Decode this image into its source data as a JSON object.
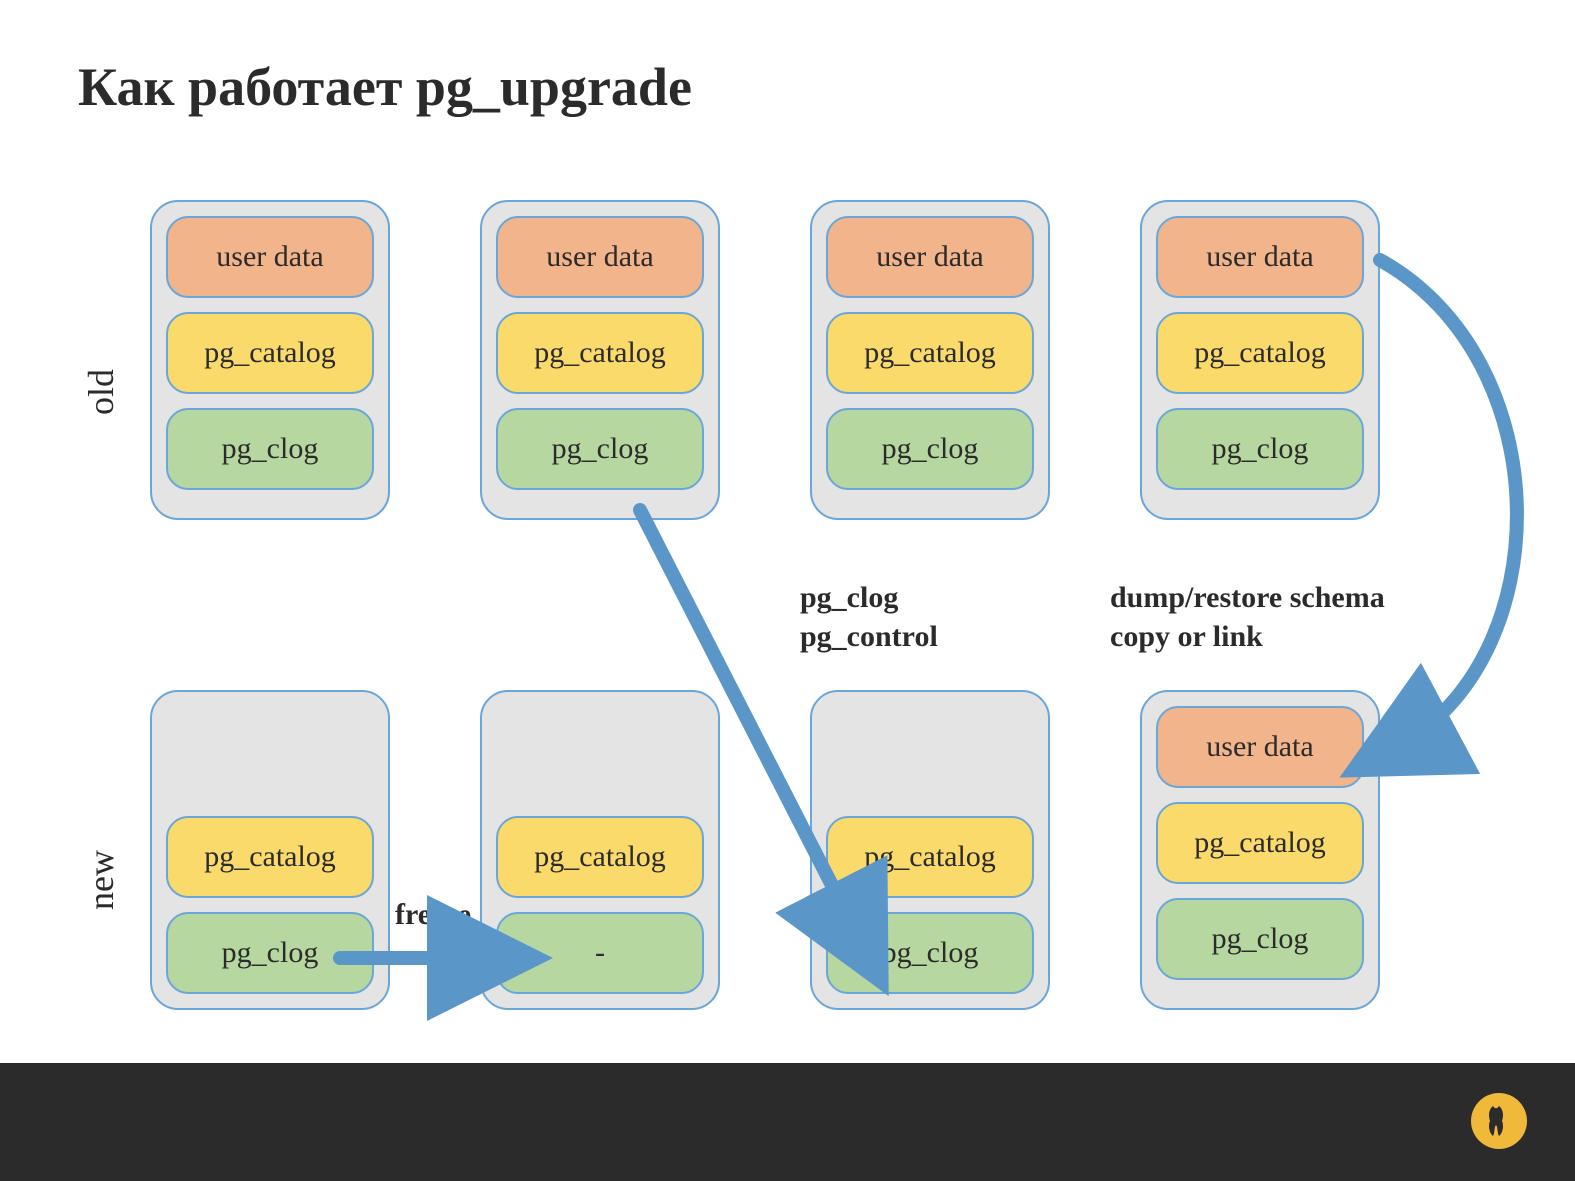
{
  "title": "Как работает pg_upgrade",
  "rows": {
    "old": "old",
    "new": "new"
  },
  "boxes": {
    "user_data": "user data",
    "catalog": "pg_catalog",
    "clog": "pg_clog",
    "dash": "-"
  },
  "annotations": {
    "freeze": "freeze",
    "col3_line1": "pg_clog",
    "col3_line2": "pg_control",
    "col4_line1": "dump/restore schema",
    "col4_line2": "copy or link"
  },
  "colors": {
    "user_data": "#f2b48a",
    "catalog": "#fada6a",
    "clog": "#b6d7a0",
    "cluster_bg": "#e4e4e4",
    "border": "#6aa6d8",
    "arrow": "#5b96c8",
    "footer": "#2b2b2b",
    "logo": "#f0b93a"
  }
}
